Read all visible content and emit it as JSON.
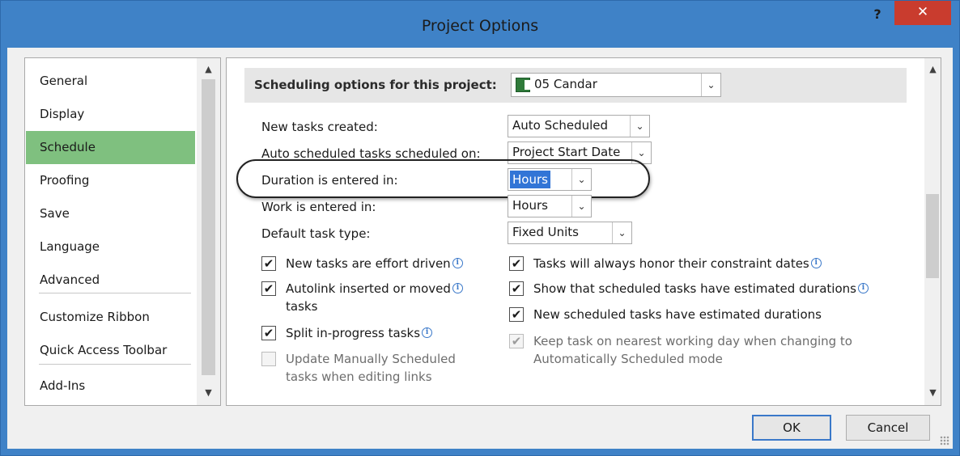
{
  "window": {
    "title": "Project Options",
    "help_label": "?",
    "close_label": "✕"
  },
  "nav": {
    "items": [
      {
        "label": "General"
      },
      {
        "label": "Display"
      },
      {
        "label": "Schedule",
        "selected": true
      },
      {
        "label": "Proofing"
      },
      {
        "label": "Save"
      },
      {
        "label": "Language"
      },
      {
        "label": "Advanced"
      },
      {
        "label": "Customize Ribbon"
      },
      {
        "label": "Quick Access Toolbar"
      },
      {
        "label": "Add-Ins"
      }
    ]
  },
  "section": {
    "label": "Scheduling options for this project:",
    "project": "05 Candar"
  },
  "fields": {
    "new_tasks_label": "New tasks created:",
    "new_tasks_value": "Auto Scheduled",
    "auto_sched_label": "Auto scheduled tasks scheduled on:",
    "auto_sched_value": "Project Start Date",
    "duration_label": "Duration is entered in:",
    "duration_value": "Hours",
    "work_label": "Work is entered in:",
    "work_value": "Hours",
    "task_type_label": "Default task type:",
    "task_type_value": "Fixed Units"
  },
  "checkboxes": {
    "effort_driven": {
      "label": "New tasks are effort driven",
      "checked": true
    },
    "autolink_line1": {
      "label": "Autolink inserted or moved",
      "checked": true
    },
    "autolink_line2": "tasks",
    "split_tasks": {
      "label": "Split in-progress tasks",
      "checked": true
    },
    "update_manual_line1": {
      "label": "Update Manually Scheduled",
      "checked": false,
      "disabled": true
    },
    "update_manual_line2": "tasks when editing links",
    "honor_constraints": {
      "label": "Tasks will always honor their constraint dates",
      "checked": true
    },
    "show_estimated": {
      "label": "Show that scheduled tasks have estimated durations",
      "checked": true
    },
    "new_estimated": {
      "label": "New scheduled tasks have estimated durations",
      "checked": true
    },
    "keep_working_line1": {
      "label": "Keep task on nearest working day when changing to",
      "checked": true,
      "disabled": true
    },
    "keep_working_line2": "Automatically Scheduled mode"
  },
  "buttons": {
    "ok": "OK",
    "cancel": "Cancel"
  },
  "icons": {
    "check": "✔",
    "info": "i",
    "dropdown": "⌄",
    "scroll_up": "▲",
    "scroll_down": "▼"
  },
  "colors": {
    "title_bar": "#3f82c7",
    "close_button": "#c93c2e",
    "nav_selected": "#7fc07f",
    "selection": "#3275d6"
  }
}
